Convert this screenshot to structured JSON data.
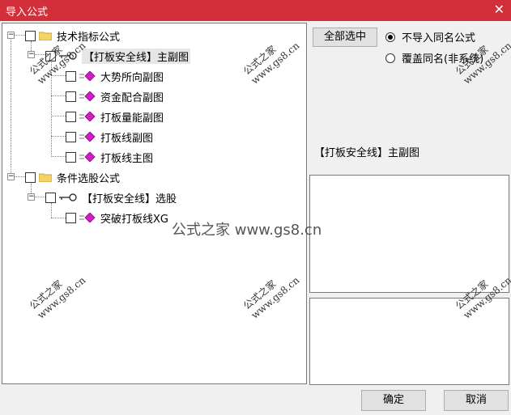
{
  "window": {
    "title": "导入公式",
    "close_glyph": "✕"
  },
  "tree": [
    {
      "label": "技术指标公式",
      "type": "folder"
    },
    {
      "label": "【打板安全线】主副图",
      "type": "formula"
    },
    {
      "label": "大势所向副图",
      "type": "item"
    },
    {
      "label": "资金配合副图",
      "type": "item"
    },
    {
      "label": "打板量能副图",
      "type": "item"
    },
    {
      "label": "打板线副图",
      "type": "item"
    },
    {
      "label": "打板线主图",
      "type": "item"
    },
    {
      "label": "条件选股公式",
      "type": "folder"
    },
    {
      "label": "【打板安全线】选股",
      "type": "formula"
    },
    {
      "label": "突破打板线XG",
      "type": "item"
    }
  ],
  "controls": {
    "select_all": "全部选中",
    "radio_no_import": "不导入同名公式",
    "radio_overwrite": "覆盖同名(非系统)",
    "selected_formula": "【打板安全线】主副图",
    "ok": "确定",
    "cancel": "取消"
  },
  "watermark": {
    "small": "公式之家",
    "url": "www.gs8.cn",
    "big": "公式之家 www.gs8.cn"
  },
  "icons": {
    "folder": "folder-icon",
    "key": "key-icon",
    "gem": "gem-icon",
    "expand": "minus-icon"
  }
}
